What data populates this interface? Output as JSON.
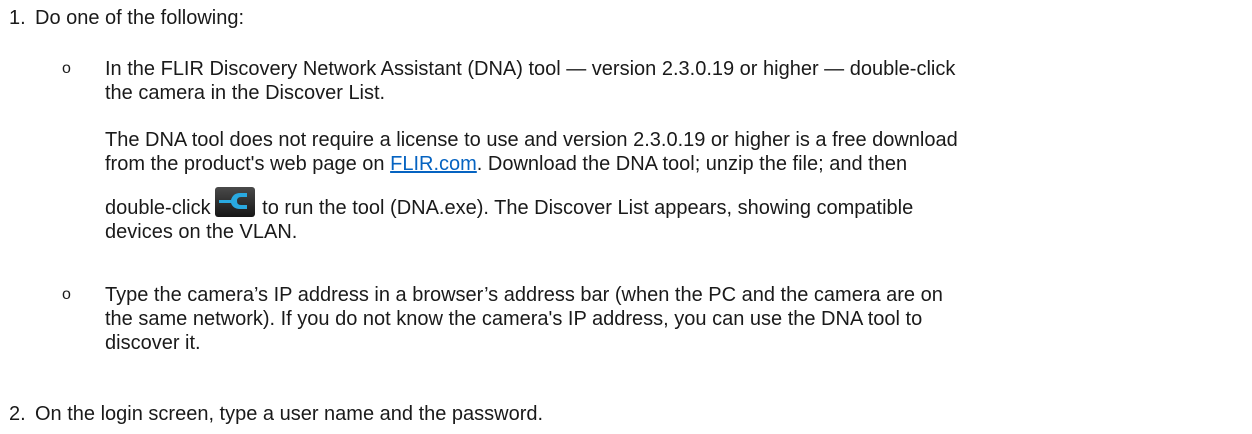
{
  "steps": [
    {
      "number": "1.",
      "text": "Do one of the following:"
    },
    {
      "number": "2.",
      "text": "On the login screen, type a user name and the password."
    }
  ],
  "options": {
    "bullet": "o",
    "option1": {
      "line1": "In the FLIR Discovery Network Assistant (DNA) tool — version 2.3.0.19 or higher — double-click",
      "line2": "the camera in the Discover List."
    },
    "note": {
      "line1": "The DNA tool does not require a license to use and version 2.3.0.19 or higher is a free download",
      "line2_before": "from the product's web page on ",
      "link": "FLIR.com",
      "line2_after": ". Download the DNA tool; unzip the file; and then",
      "line3_before": "double-click",
      "line3_after": "to run the tool (DNA.exe). The Discover List appears, showing compatible",
      "line4": "devices on the VLAN.",
      "icon": "dna-tool-wrench-icon"
    },
    "option2": {
      "line1": "Type the camera’s IP address in a browser’s address bar (when the PC and the camera are on",
      "line2": "the same network). If you do not know the camera's IP address, you can use the DNA tool to",
      "line3": "discover it."
    }
  },
  "colors": {
    "text": "#1a1a1a",
    "link": "#0563c1"
  }
}
